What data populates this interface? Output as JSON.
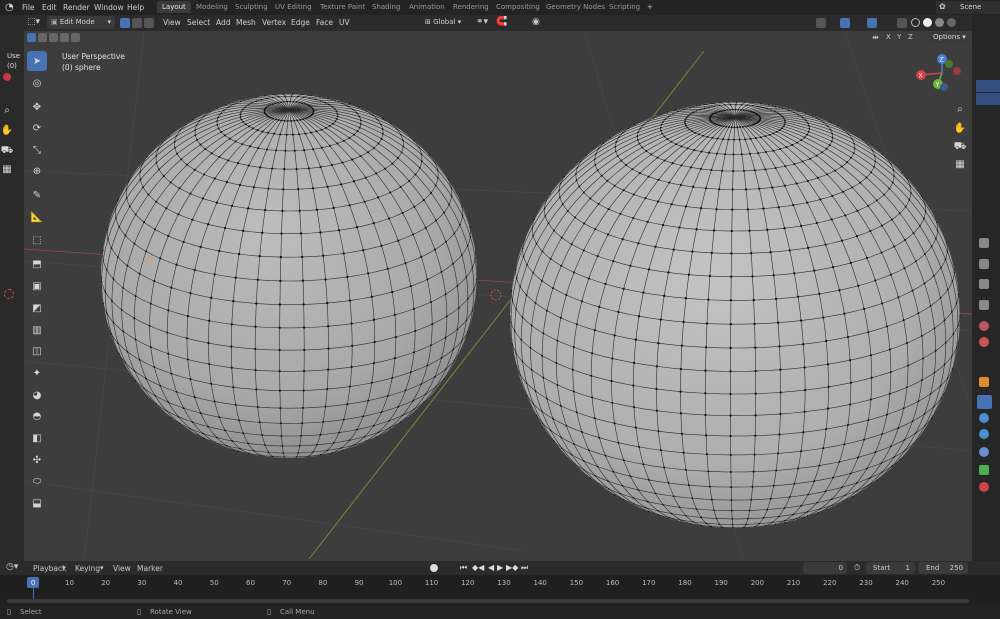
{
  "topbar": {
    "menus": [
      "File",
      "Edit",
      "Render",
      "Window",
      "Help"
    ],
    "workspaces": [
      "Layout",
      "Modeling",
      "Sculpting",
      "UV Editing",
      "Texture Paint",
      "Shading",
      "Animation",
      "Rendering",
      "Compositing",
      "Geometry Nodes",
      "Scripting"
    ],
    "active_workspace": "Layout",
    "add_tab": "+",
    "scene": "Scene"
  },
  "header": {
    "mode": "Edit Mode",
    "menus": [
      "View",
      "Select",
      "Add",
      "Mesh",
      "Vertex",
      "Edge",
      "Face",
      "UV"
    ],
    "transform_orientation": "Global",
    "axes": [
      "X",
      "Y",
      "Z"
    ],
    "options": "Options"
  },
  "viewport": {
    "perspective": "User Perspective",
    "object": "(0) sphere",
    "left_clip_line1": "Use",
    "left_clip_line2": "(0)"
  },
  "gizmo": {
    "x": "X",
    "y": "Y",
    "z": "Z"
  },
  "timeline": {
    "menus": [
      "Playback",
      "Keying",
      "View",
      "Marker"
    ],
    "current_frame": "0",
    "start_label": "Start",
    "start": "1",
    "end_label": "End",
    "end": "250",
    "ticks": [
      "0",
      "10",
      "20",
      "30",
      "40",
      "50",
      "60",
      "70",
      "80",
      "90",
      "100",
      "110",
      "120",
      "130",
      "140",
      "150",
      "160",
      "170",
      "180",
      "190",
      "200",
      "210",
      "220",
      "230",
      "240",
      "250"
    ]
  },
  "status": {
    "select": "Select",
    "rotate": "Rotate View",
    "menu": "Call Menu"
  },
  "colors": {
    "accent": "#4772b3",
    "vertex": "#111111",
    "mesh": "#b5b5b5"
  }
}
